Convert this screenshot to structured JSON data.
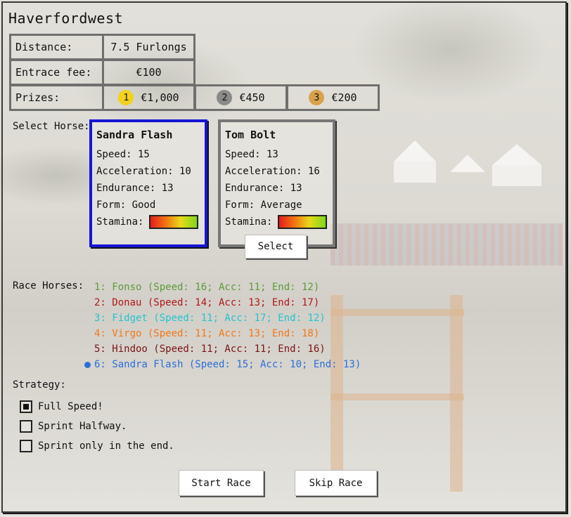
{
  "race": {
    "title": "Haverfordwest",
    "distance_label": "Distance:",
    "distance_value": "7.5 Furlongs",
    "fee_label": "Entrace fee:",
    "fee_value": "€100",
    "prizes_label": "Prizes:",
    "prizes": [
      {
        "place": "1",
        "amount": "€1,000",
        "color": "#f2d21a"
      },
      {
        "place": "2",
        "amount": "€450",
        "color": "#8a8a8a"
      },
      {
        "place": "3",
        "amount": "€200",
        "color": "#d9a24a"
      }
    ]
  },
  "select_horse": {
    "label": "Select Horse:",
    "horses": [
      {
        "name": "Sandra Flash",
        "speed": "Speed: 15",
        "acceleration": "Acceleration: 10",
        "endurance": "Endurance: 13",
        "form": "Form: Good",
        "stamina_label": "Stamina:",
        "selected": true
      },
      {
        "name": "Tom Bolt",
        "speed": "Speed: 13",
        "acceleration": "Acceleration: 16",
        "endurance": "Endurance: 13",
        "form": "Form: Average",
        "stamina_label": "Stamina:",
        "selected": false
      }
    ],
    "select_button": "Select"
  },
  "race_horses": {
    "label": "Race Horses:",
    "entries": [
      {
        "text": "1: Fonso (Speed: 16; Acc: 11; End: 12)",
        "color": "#5e9a3a"
      },
      {
        "text": "2: Donau (Speed: 14; Acc: 13; End: 17)",
        "color": "#b01818"
      },
      {
        "text": "3: Fidget (Speed: 11; Acc: 17; End: 12)",
        "color": "#22c4d0"
      },
      {
        "text": "4: Virgo (Speed: 11; Acc: 13; End: 18)",
        "color": "#f07818"
      },
      {
        "text": "5: Hindoo (Speed: 11; Acc: 11; End: 16)",
        "color": "#7a1414"
      },
      {
        "text": "6: Sandra Flash (Speed: 15; Acc: 10; End: 13)",
        "color": "#2a6fd8"
      }
    ]
  },
  "strategy": {
    "label": "Strategy:",
    "options": [
      {
        "label": "Full Speed!",
        "checked": true
      },
      {
        "label": "Sprint Halfway.",
        "checked": false
      },
      {
        "label": "Sprint only in the end.",
        "checked": false
      }
    ]
  },
  "actions": {
    "start_label": "Start Race",
    "skip_label": "Skip Race"
  }
}
